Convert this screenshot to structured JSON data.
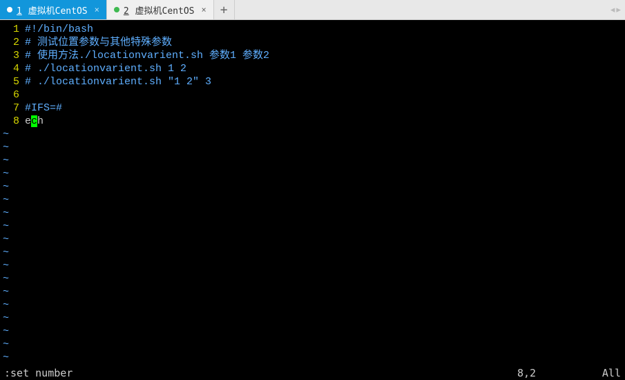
{
  "tabs": [
    {
      "num": "1",
      "label": "虚拟机CentOS",
      "active": true
    },
    {
      "num": "2",
      "label": "虚拟机CentOS",
      "active": false
    }
  ],
  "editor": {
    "lines": [
      {
        "n": "1",
        "text": "#!/bin/bash"
      },
      {
        "n": "2",
        "text": "# 测试位置参数与其他特殊参数"
      },
      {
        "n": "3",
        "text": "# 使用方法./locationvarient.sh 参数1 参数2"
      },
      {
        "n": "4",
        "text": "# ./locationvarient.sh 1 2"
      },
      {
        "n": "5",
        "text": "# ./locationvarient.sh \"1 2\" 3"
      },
      {
        "n": "6",
        "text": ""
      },
      {
        "n": "7",
        "text": "#IFS=#"
      }
    ],
    "cursor_line": {
      "n": "8",
      "before": "e",
      "at": "c",
      "after": "h"
    },
    "tilde": "~",
    "tilde_count": 18
  },
  "status": {
    "command": ":set number",
    "position": "8,2",
    "percent": "All"
  }
}
